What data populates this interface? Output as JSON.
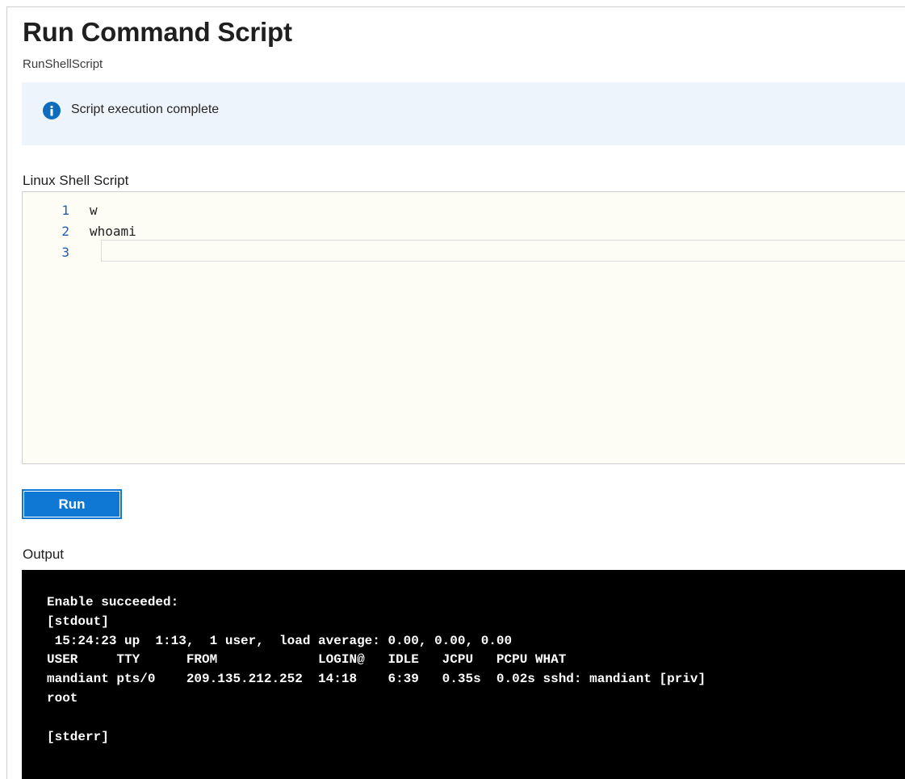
{
  "header": {
    "title": "Run Command Script",
    "subtitle": "RunShellScript"
  },
  "banner": {
    "icon": "info-icon",
    "message": "Script execution complete",
    "color": "#0f6cbd"
  },
  "editor": {
    "label": "Linux Shell Script",
    "lines": [
      {
        "number": "1",
        "code": "w"
      },
      {
        "number": "2",
        "code": "whoami"
      },
      {
        "number": "3",
        "code": ""
      }
    ]
  },
  "actions": {
    "run_label": "Run",
    "accent": "#0f78d4"
  },
  "output": {
    "label": "Output",
    "lines": [
      "Enable succeeded:",
      "[stdout]",
      " 15:24:23 up  1:13,  1 user,  load average: 0.00, 0.00, 0.00",
      "USER     TTY      FROM             LOGIN@   IDLE   JCPU   PCPU WHAT",
      "mandiant pts/0    209.135.212.252  14:18    6:39   0.35s  0.02s sshd: mandiant [priv]",
      "root",
      "",
      "[stderr]"
    ]
  }
}
